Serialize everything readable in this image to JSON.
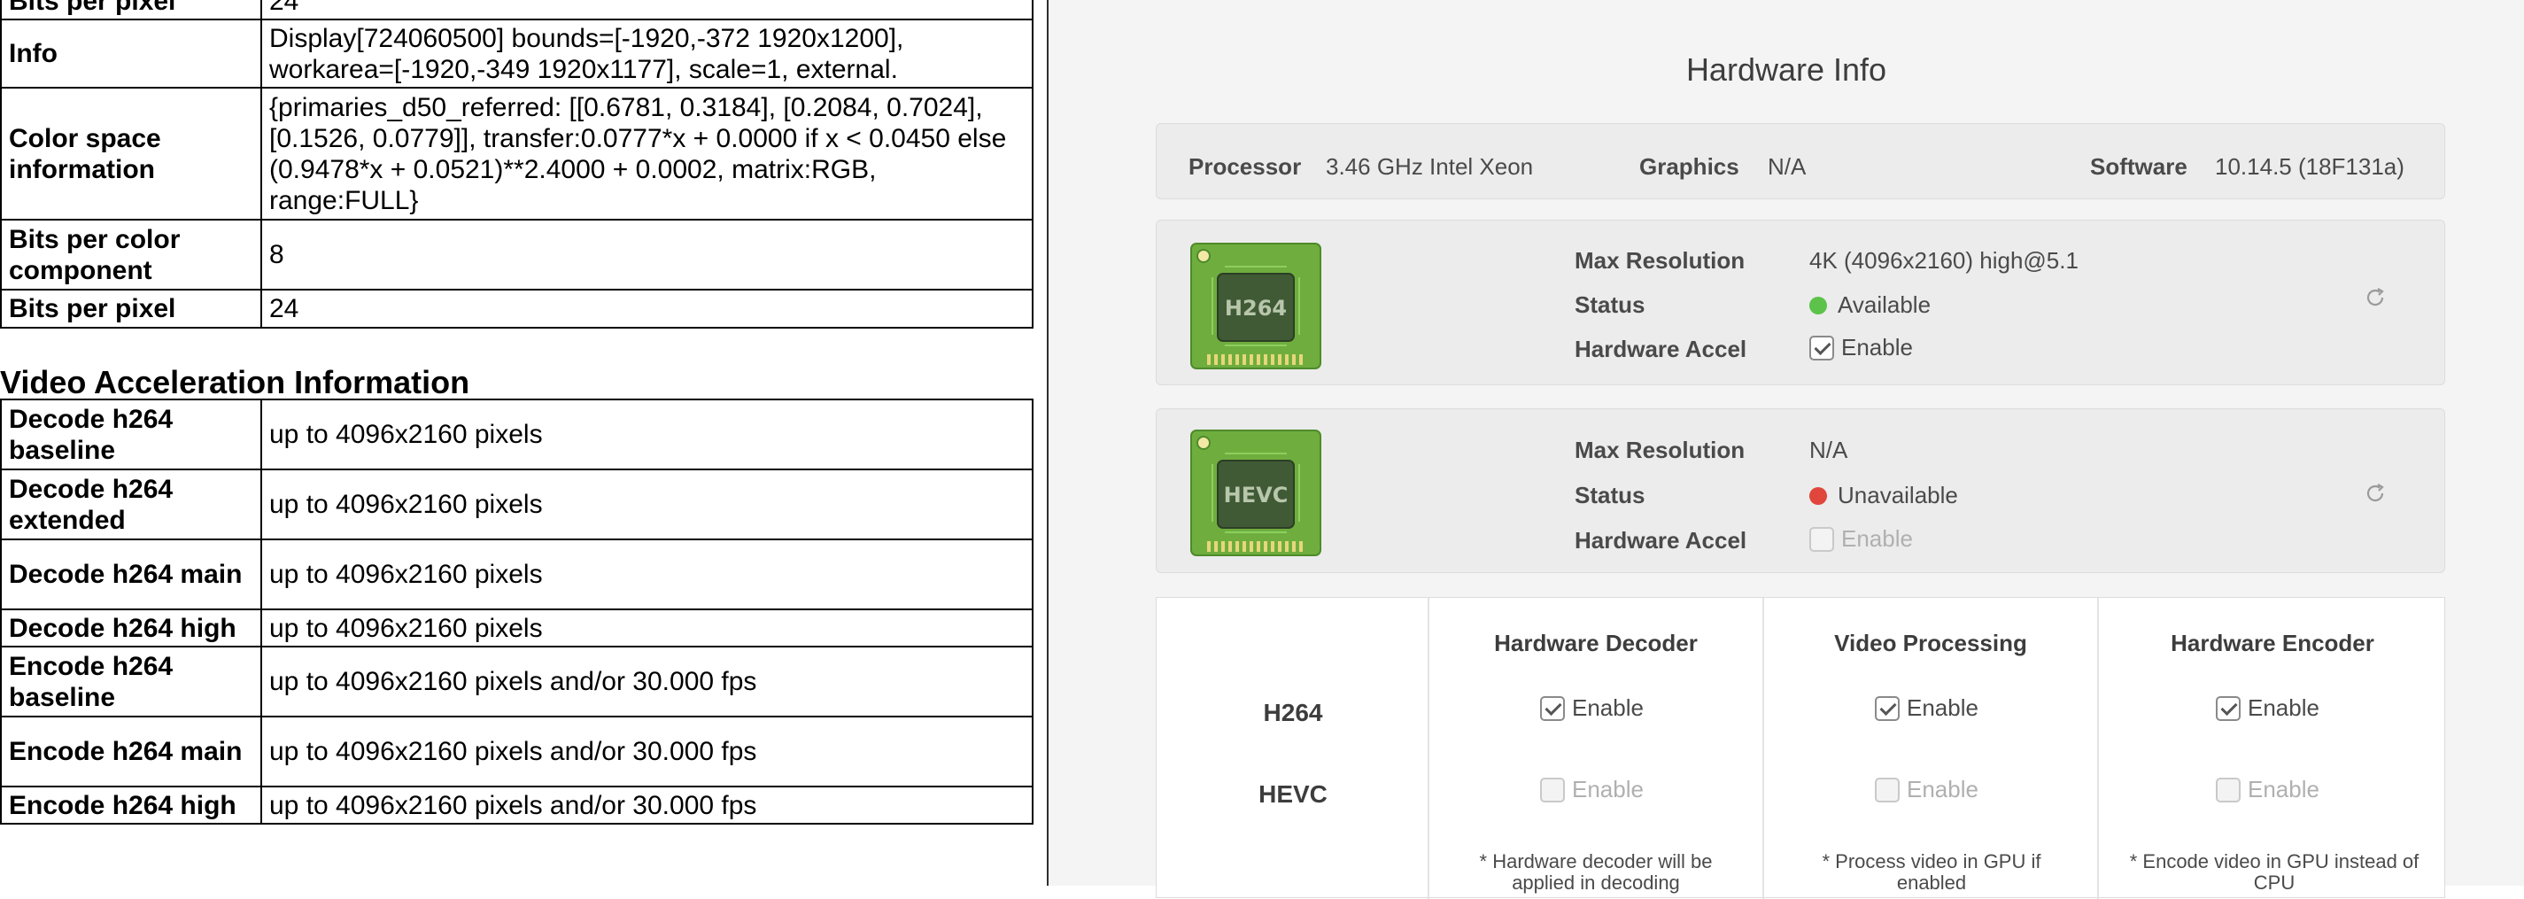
{
  "gpu_table_top": [
    {
      "key": "Bits per pixel",
      "value": "24"
    },
    {
      "key": "Info",
      "value": "Display[724060500] bounds=[-1920,-372 1920x1200], workarea=[-1920,-349 1920x1177], scale=1, external."
    },
    {
      "key": "Color space information",
      "value": "{primaries_d50_referred: [[0.6781, 0.3184], [0.2084, 0.7024], [0.1526, 0.0779]], transfer:0.0777*x + 0.0000 if x < 0.0450 else (0.9478*x + 0.0521)**2.4000 + 0.0002, matrix:RGB, range:FULL}"
    },
    {
      "key": "Bits per color component",
      "value": "8"
    },
    {
      "key": "Bits per pixel",
      "value": "24"
    }
  ],
  "video_section_title": "Video Acceleration Information",
  "video_table": [
    {
      "key": "Decode h264 baseline",
      "value": "up to 4096x2160 pixels"
    },
    {
      "key": "Decode h264 extended",
      "value": "up to 4096x2160 pixels"
    },
    {
      "key": "Decode h264 main",
      "value": "up to 4096x2160 pixels"
    },
    {
      "key": "Decode h264 high",
      "value": "up to 4096x2160 pixels"
    },
    {
      "key": "Encode h264 baseline",
      "value": "up to 4096x2160 pixels and/or 30.000 fps"
    },
    {
      "key": "Encode h264 main",
      "value": "up to 4096x2160 pixels and/or 30.000 fps"
    },
    {
      "key": "Encode h264 high",
      "value": "up to 4096x2160 pixels and/or 30.000 fps"
    }
  ],
  "hardware_info": {
    "title": "Hardware Info",
    "processor_label": "Processor",
    "processor_value": "3.46 GHz Intel Xeon",
    "graphics_label": "Graphics",
    "graphics_value": "N/A",
    "software_label": "Software",
    "software_value": "10.14.5 (18F131a)"
  },
  "codec_cards": [
    {
      "chip_label": "H264",
      "max_res_label": "Max Resolution",
      "max_res_value": "4K (4096x2160) high@5.1",
      "status_label": "Status",
      "status_value": "Available",
      "status_color": "#5cc24a",
      "accel_label": "Hardware Accel",
      "accel_text": "Enable",
      "accel_checked": true,
      "accel_enabled": true
    },
    {
      "chip_label": "HEVC",
      "max_res_label": "Max Resolution",
      "max_res_value": "N/A",
      "status_label": "Status",
      "status_value": "Unavailable",
      "status_color": "#e0463c",
      "accel_label": "Hardware Accel",
      "accel_text": "Enable",
      "accel_checked": false,
      "accel_enabled": false
    }
  ],
  "capabilities": {
    "columns": [
      "Hardware Decoder",
      "Video Processing",
      "Hardware Encoder"
    ],
    "rows": [
      {
        "codec": "H264",
        "checks": [
          true,
          true,
          true
        ],
        "enabled": true,
        "label": "Enable"
      },
      {
        "codec": "HEVC",
        "checks": [
          false,
          false,
          false
        ],
        "enabled": false,
        "label": "Enable"
      }
    ],
    "notes": [
      "* Hardware decoder will be applied in decoding",
      "* Process video in GPU if enabled",
      "* Encode video in GPU instead of CPU"
    ]
  },
  "colors": {
    "chip_green": "#6fae3e",
    "chip_dark": "#3f5a35",
    "available_green": "#5cc24a",
    "unavailable_red": "#e0463c"
  }
}
